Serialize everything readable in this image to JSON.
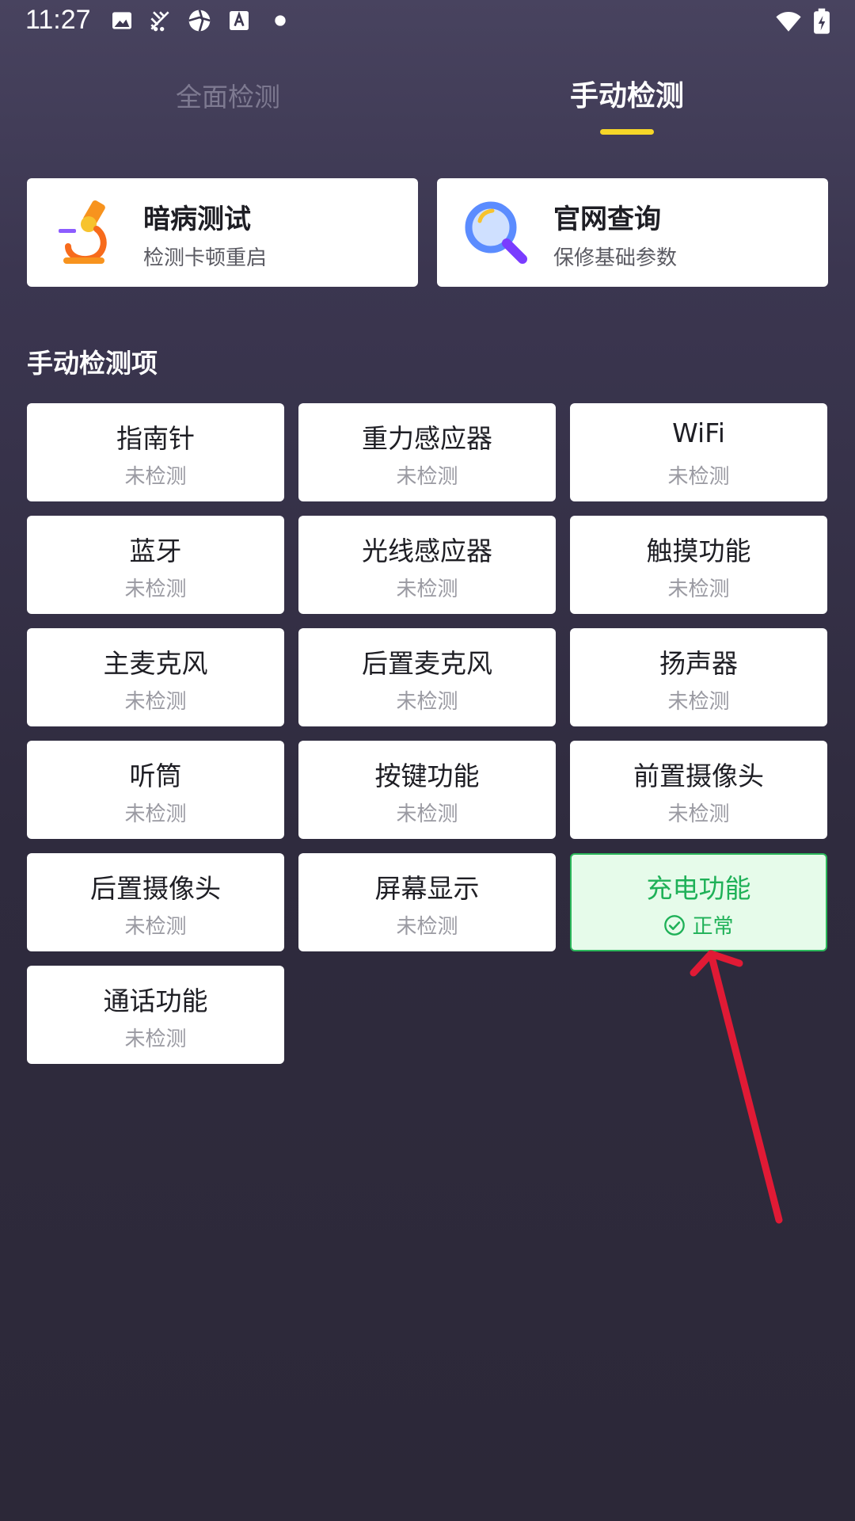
{
  "status_bar": {
    "time": "11:27",
    "left_icons": [
      "image-icon",
      "fan-icon",
      "aperture-icon",
      "font-icon",
      "dot-icon"
    ],
    "right_icons": [
      "wifi-icon",
      "battery-charging-icon"
    ]
  },
  "tabs": [
    {
      "label": "全面检测",
      "active": false
    },
    {
      "label": "手动检测",
      "active": true
    }
  ],
  "top_cards": [
    {
      "title": "暗病测试",
      "subtitle": "检测卡顿重启",
      "icon": "microscope-icon"
    },
    {
      "title": "官网查询",
      "subtitle": "保修基础参数",
      "icon": "magnifier-icon"
    }
  ],
  "section_title": "手动检测项",
  "items": [
    {
      "label": "指南针",
      "status": "未检测"
    },
    {
      "label": "重力感应器",
      "status": "未检测"
    },
    {
      "label": "WiFi",
      "status": "未检测"
    },
    {
      "label": "蓝牙",
      "status": "未检测"
    },
    {
      "label": "光线感应器",
      "status": "未检测"
    },
    {
      "label": "触摸功能",
      "status": "未检测"
    },
    {
      "label": "主麦克风",
      "status": "未检测"
    },
    {
      "label": "后置麦克风",
      "status": "未检测"
    },
    {
      "label": "扬声器",
      "status": "未检测"
    },
    {
      "label": "听筒",
      "status": "未检测"
    },
    {
      "label": "按键功能",
      "status": "未检测"
    },
    {
      "label": "前置摄像头",
      "status": "未检测"
    },
    {
      "label": "后置摄像头",
      "status": "未检测"
    },
    {
      "label": "屏幕显示",
      "status": "未检测"
    },
    {
      "label": "充电功能",
      "status": "正常"
    },
    {
      "label": "通话功能",
      "status": "未检测"
    }
  ],
  "colors": {
    "accent_yellow": "#f6d628",
    "ok_green": "#1fb158",
    "annotation_red": "#e01a35"
  }
}
